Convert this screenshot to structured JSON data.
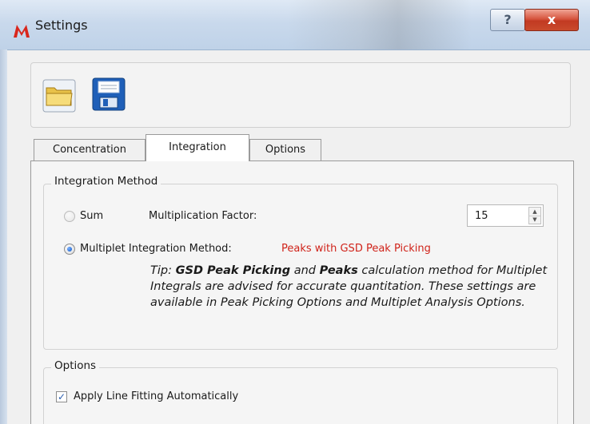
{
  "window": {
    "title": "Settings"
  },
  "titlebar": {
    "help_label": "?",
    "close_label": "x",
    "app_icon": "app-logo-icon"
  },
  "toolbar": {
    "open_icon": "folder-open-icon",
    "save_icon": "floppy-save-icon"
  },
  "tabs": [
    {
      "label": "Concentration",
      "active": false
    },
    {
      "label": "Integration",
      "active": true
    },
    {
      "label": "Options",
      "active": false
    }
  ],
  "integration_method": {
    "group_title": "Integration Method",
    "sum_label": "Sum",
    "multiplication_factor_label": "Multiplication Factor:",
    "multiplication_factor_value": "15",
    "multiplet_label": "Multiplet Integration Method:",
    "multiplet_value": "Peaks with GSD Peak Picking",
    "selected": "multiplet",
    "tip": {
      "prefix": "Tip: ",
      "bold1": "GSD Peak Picking",
      "mid1": " and ",
      "bold2": "Peaks",
      "rest": " calculation method for Multiplet Integrals are advised for accurate quantitation. These settings are available in Peak Picking Options and Multiplet Analysis Options."
    }
  },
  "options_group": {
    "group_title": "Options",
    "apply_line_fitting_label": "Apply Line Fitting Automatically",
    "apply_line_fitting_checked": true
  },
  "colors": {
    "accent_red": "#d0231a",
    "close_red": "#c94a2c"
  }
}
